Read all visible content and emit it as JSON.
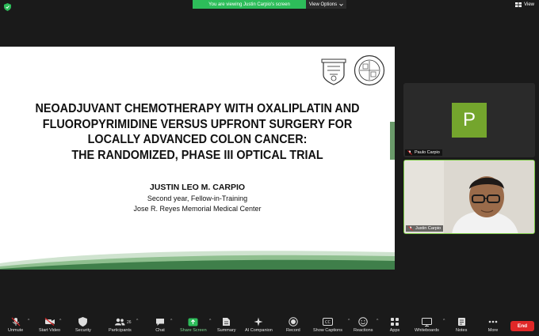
{
  "banner": {
    "viewing_text": "You are viewing Justin Carpio's screen",
    "view_options_label": "View Options"
  },
  "top_right": {
    "view_label": "View"
  },
  "slide": {
    "title_lines": [
      "NEOADJUVANT CHEMOTHERAPY WITH OXALIPLATIN AND",
      "FLUOROPYRIMIDINE VERSUS UPFRONT SURGERY FOR",
      "LOCALLY ADVANCED COLON CANCER:",
      "THE RANDOMIZED, PHASE III OPTICAL TRIAL"
    ],
    "author": "JUSTIN LEO M. CARPIO",
    "role": "Second year, Fellow-in-Training",
    "institution": "Jose R. Reyes Memorial Medical Center"
  },
  "participants": [
    {
      "name": "Paulo Carpio",
      "initial": "P",
      "avatar_color": "#74a52d",
      "muted": true
    },
    {
      "name": "Justin Carpio",
      "muted": true,
      "active_speaker": true
    }
  ],
  "toolbar": {
    "unmute": "Unmute",
    "start_video": "Start Video",
    "security": "Security",
    "participants": "Participants",
    "participants_count": "26",
    "chat": "Chat",
    "share_screen": "Share Screen",
    "summary": "Summary",
    "ai_companion": "AI Companion",
    "record": "Record",
    "show_captions": "Show Captions",
    "reactions": "Reactions",
    "apps": "Apps",
    "whiteboards": "Whiteboards",
    "notes": "Notes",
    "more": "More",
    "end": "End"
  },
  "colors": {
    "banner_green": "#2dbd5a",
    "avatar_green": "#74a52d",
    "active_border": "#7ac943",
    "end_red": "#e02828"
  }
}
